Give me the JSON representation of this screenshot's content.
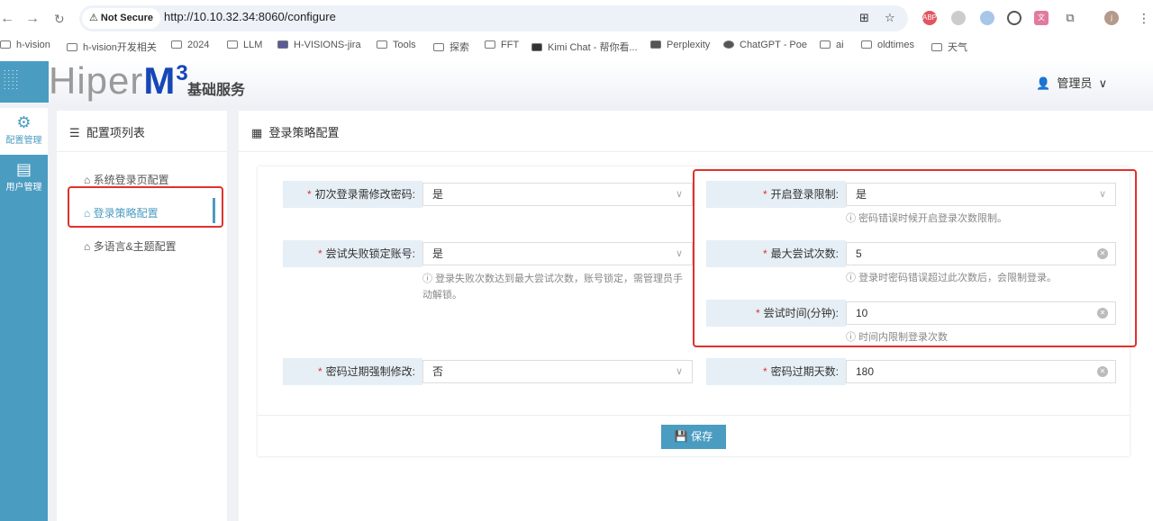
{
  "browser": {
    "not_secure": "Not Secure",
    "url": "http://10.10.32.34:8060/configure",
    "profile": "j",
    "bookmarks": [
      "h-vision",
      "h-vision开发相关",
      "2024",
      "LLM",
      "H-VISIONS-jira",
      "Tools",
      "探索",
      "FFT",
      "Kimi Chat - 帮你看...",
      "Perplexity",
      "ChatGPT - Poe",
      "ai",
      "oldtimes",
      "天气"
    ]
  },
  "app": {
    "logo_text": "Hiper",
    "logo_m": "M",
    "logo_sup": "3",
    "subtitle": "基础服务",
    "user": "管理员"
  },
  "sidebar": [
    {
      "label": "配置管理"
    },
    {
      "label": "用户管理"
    }
  ],
  "list": {
    "title": "配置项列表",
    "items": [
      "系统登录页配置",
      "登录策略配置",
      "多语言&主题配置"
    ]
  },
  "main": {
    "title": "登录策略配置",
    "fields": {
      "first_login": {
        "label": "初次登录需修改密码",
        "value": "是"
      },
      "lock": {
        "label": "尝试失败锁定账号",
        "value": "是",
        "hint": "登录失败次数达到最大尝试次数，账号锁定，需管理员手动解锁。"
      },
      "expire_force": {
        "label": "密码过期强制修改",
        "value": "否"
      },
      "enable_limit": {
        "label": "开启登录限制",
        "value": "是",
        "hint": "密码错误时候开启登录次数限制。"
      },
      "max_tries": {
        "label": "最大尝试次数",
        "value": "5",
        "hint": "登录时密码错误超过此次数后，会限制登录。"
      },
      "try_time": {
        "label": "尝试时间(分钟)",
        "value": "10",
        "hint": "时间内限制登录次数"
      },
      "expire_days": {
        "label": "密码过期天数",
        "value": "180"
      }
    },
    "save": "保存"
  }
}
